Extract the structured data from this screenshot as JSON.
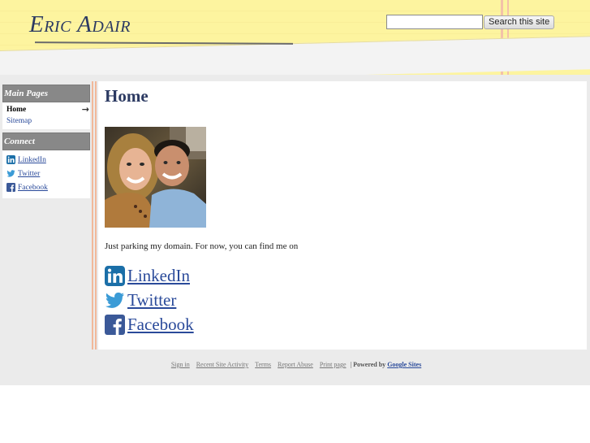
{
  "header": {
    "site_title": "Eric Adair",
    "search_placeholder": "",
    "search_button": "Search this site"
  },
  "sidebar": {
    "main_pages_heading": "Main Pages",
    "nav": [
      {
        "label": "Home",
        "current": true
      },
      {
        "label": "Sitemap",
        "current": false
      }
    ],
    "connect_heading": "Connect",
    "connect": [
      {
        "label": "LinkedIn",
        "icon": "linkedin-icon"
      },
      {
        "label": "Twitter",
        "icon": "twitter-icon"
      },
      {
        "label": "Facebook",
        "icon": "facebook-icon"
      }
    ]
  },
  "main": {
    "title": "Home",
    "intro": "Just parking my domain. For now, you can find me on",
    "links": [
      {
        "label": "LinkedIn",
        "icon": "linkedin-icon"
      },
      {
        "label": "Twitter",
        "icon": "twitter-icon"
      },
      {
        "label": "Facebook",
        "icon": "facebook-icon"
      }
    ]
  },
  "footer": {
    "links": [
      "Sign in",
      "Recent Site Activity",
      "Terms",
      "Report Abuse",
      "Print page"
    ],
    "separator": "|",
    "powered_by": "Powered by",
    "google_sites": "Google Sites"
  },
  "colors": {
    "header_bg": "#fdf49f",
    "title_color": "#2c3a62",
    "link_color": "#2a4a9a",
    "sidebar_header_bg": "#888888"
  }
}
